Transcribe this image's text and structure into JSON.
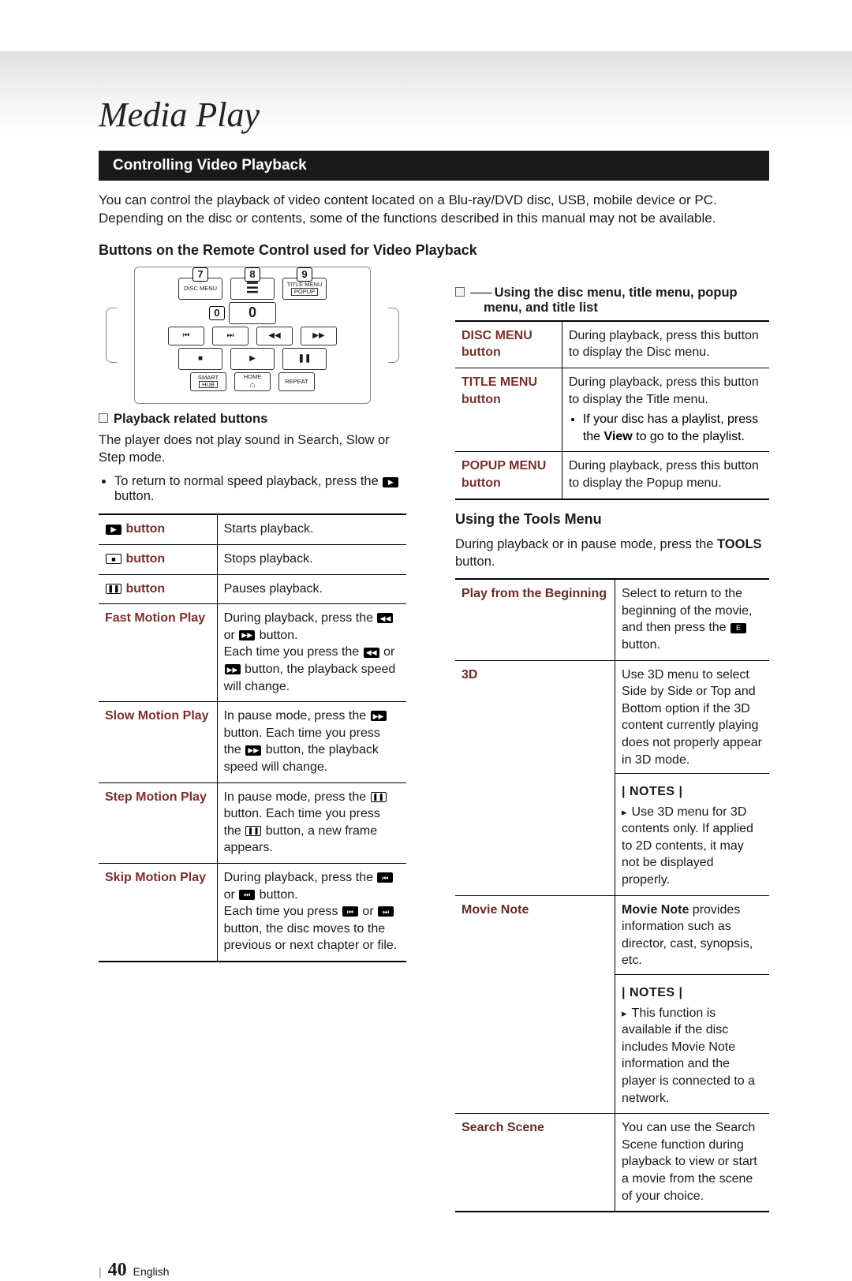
{
  "pageTitle": "Media Play",
  "sectionBar": "Controlling Video Playback",
  "intro": "You can control the playback of video content located on a Blu-ray/DVD disc, USB, mobile device or PC. Depending on the disc or contents, some of the functions described in this manual may not be available.",
  "remoteHeading": "Buttons on the Remote Control used for Video Playback",
  "remote": {
    "callouts": [
      "7",
      "8",
      "9",
      "0"
    ],
    "r1": {
      "a": "DISC MENU",
      "c_top": "TITLE MENU",
      "c_bot": "POPUP"
    },
    "r3": {
      "a": "SMART",
      "b": "HUB",
      "c": "HOME",
      "d": "REPEAT"
    }
  },
  "playbackSub": "Playback related buttons",
  "playbackNote": "The player does not play sound in Search, Slow or Step mode.",
  "playbackBullet": "To return to normal speed playback, press the 6 button.",
  "playbackTable": [
    {
      "label": "6 button",
      "desc": "Starts playback."
    },
    {
      "label": "5 button",
      "desc": "Stops playback."
    },
    {
      "label": "7 button",
      "desc": "Pauses playback."
    },
    {
      "label": "Fast Motion Play",
      "desc": "During playback, press the 3 or 4 button.\nEach time you press the 3 or 4 button, the playback speed will change."
    },
    {
      "label": "Slow Motion Play",
      "desc": "In pause mode, press the 4 button. Each time you press the 4 button, the playback speed will change."
    },
    {
      "label": "Step Motion Play",
      "desc": "In pause mode, press the 7 button. Each time you press the 7 button, a new frame appears."
    },
    {
      "label": "Skip Motion Play",
      "desc": "During playback, press the 1 or 2 button.\nEach time you press 1 or 2 button, the disc moves to the previous or next chapter or file."
    }
  ],
  "discMenuSub": "Using the disc menu, title menu, popup menu, and title list",
  "discMenuTable": [
    {
      "label": "DISC MENU button",
      "desc": "During playback, press this button to display the Disc menu."
    },
    {
      "label": "TITLE MENU button",
      "desc": "During playback, press this button to display the Title menu.",
      "bullet": "If your disc has a playlist, press the View to go to the playlist."
    },
    {
      "label": "POPUP MENU button",
      "desc": "During playback, press this button to display the Popup menu."
    }
  ],
  "toolsHeading": "Using the Tools Menu",
  "toolsIntro": "During playback or in pause mode, press the TOOLS button.",
  "toolsTable": [
    {
      "label": "Play from the Beginning",
      "desc": "Select to return to the beginning of the movie, and then press the E button."
    },
    {
      "label": "3D",
      "desc": "Use 3D menu to select Side by Side or Top and Bottom option if the 3D content currently playing does not properly appear in 3D mode.",
      "notes": "Use 3D menu for 3D contents only. If applied to 2D contents, it may not be displayed properly."
    },
    {
      "label": "Movie Note",
      "desc": "Movie Note provides information such as director, cast, synopsis, etc.",
      "notes": "This function is available if the disc includes Movie Note information and the player is connected to a network."
    },
    {
      "label": "Search Scene",
      "desc": "You can use the Search Scene function during playback to view or start a movie from the scene of your choice."
    }
  ],
  "notesLabel": "| NOTES |",
  "footer": {
    "sep": "|",
    "num": "40",
    "lang": "English"
  },
  "strongView": "View",
  "strongMovieNote": "Movie Note",
  "strongTools": "TOOLS"
}
